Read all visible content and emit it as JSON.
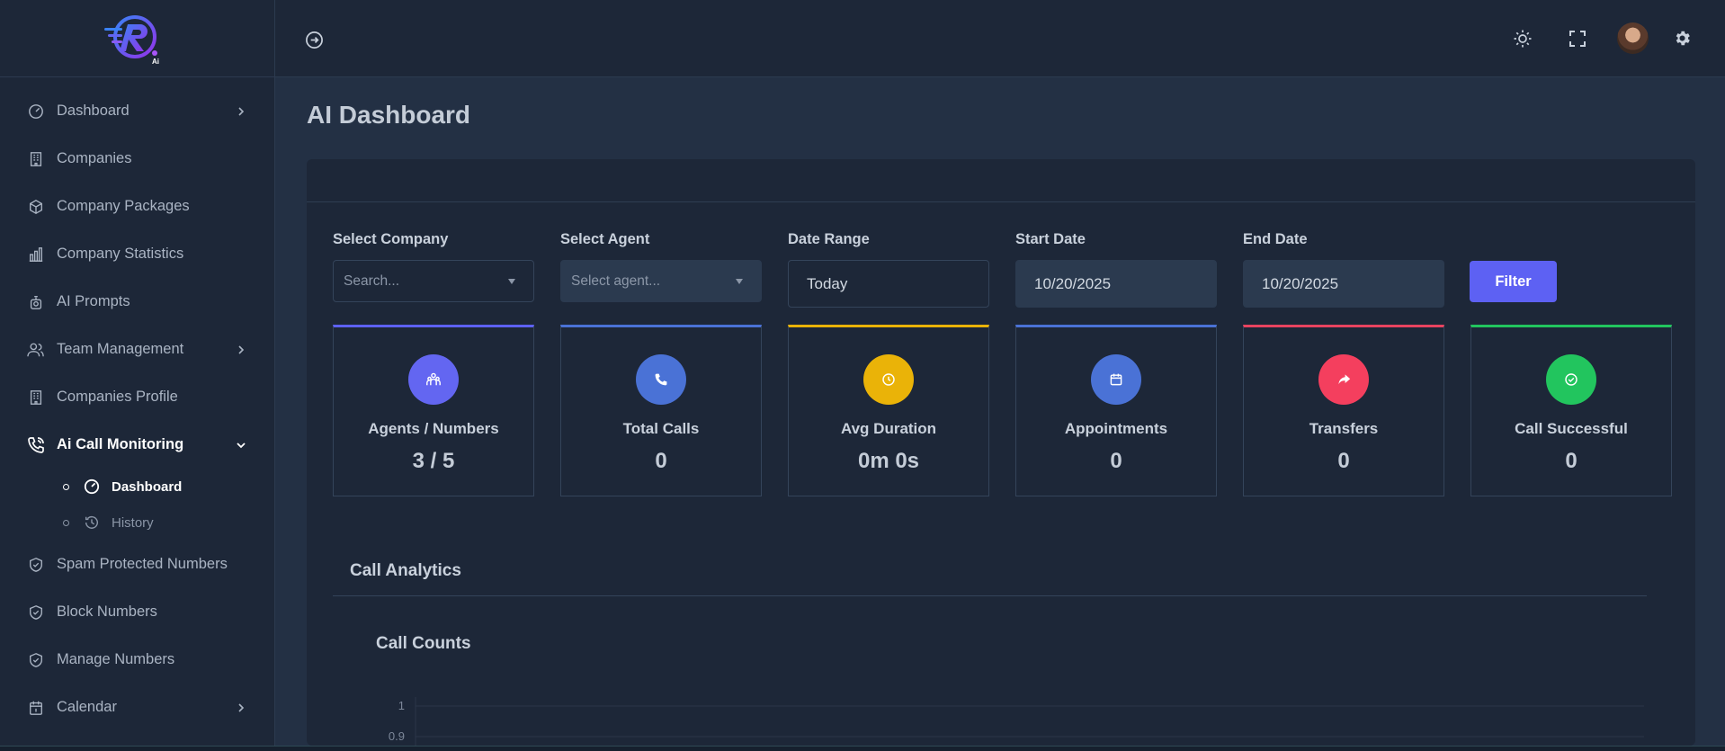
{
  "brand": {
    "logo_badge": "Ai",
    "accent": "#5d61f3"
  },
  "sidebar": {
    "items": [
      {
        "label": "Dashboard",
        "icon": "gauge-icon",
        "has_submenu": true
      },
      {
        "label": "Companies",
        "icon": "building-icon",
        "has_submenu": false
      },
      {
        "label": "Company Packages",
        "icon": "package-icon",
        "has_submenu": false
      },
      {
        "label": "Company Statistics",
        "icon": "bar-chart-icon",
        "has_submenu": false
      },
      {
        "label": "AI Prompts",
        "icon": "robot-icon",
        "has_submenu": false
      },
      {
        "label": "Team Management",
        "icon": "users-icon",
        "has_submenu": true
      },
      {
        "label": "Companies Profile",
        "icon": "building-icon",
        "has_submenu": false
      },
      {
        "label": "Ai Call Monitoring",
        "icon": "phone-call-icon",
        "has_submenu": true,
        "expanded": true,
        "children": [
          {
            "label": "Dashboard",
            "icon": "gauge-icon",
            "active": true
          },
          {
            "label": "History",
            "icon": "history-icon",
            "active": false
          }
        ]
      },
      {
        "label": "Spam Protected Numbers",
        "icon": "shield-check-icon",
        "has_submenu": false
      },
      {
        "label": "Block Numbers",
        "icon": "shield-check-icon",
        "has_submenu": false
      },
      {
        "label": "Manage Numbers",
        "icon": "shield-check-icon",
        "has_submenu": false
      },
      {
        "label": "Calendar",
        "icon": "calendar-icon",
        "has_submenu": true
      }
    ]
  },
  "topbar": {
    "icons": [
      "sidebar-toggle-icon",
      "sun-icon",
      "fullscreen-icon",
      "avatar",
      "gear-icon"
    ]
  },
  "page": {
    "title": "AI Dashboard"
  },
  "filters": {
    "company": {
      "label": "Select Company",
      "placeholder": "Search..."
    },
    "agent": {
      "label": "Select Agent",
      "placeholder": "Select agent..."
    },
    "date_range": {
      "label": "Date Range",
      "value": "Today"
    },
    "start_date": {
      "label": "Start Date",
      "value": "10/20/2025"
    },
    "end_date": {
      "label": "End Date",
      "value": "10/20/2025"
    },
    "button": "Filter"
  },
  "stats": [
    {
      "title": "Agents / Numbers",
      "value": "3 / 5",
      "color": "#6366f1",
      "border": "#5d61f3",
      "icon": "users-icon"
    },
    {
      "title": "Total Calls",
      "value": "0",
      "color": "#4a72d6",
      "border": "#4a72d6",
      "icon": "phone-icon"
    },
    {
      "title": "Avg Duration",
      "value": "0m 0s",
      "color": "#eab308",
      "border": "#eab308",
      "icon": "clock-icon"
    },
    {
      "title": "Appointments",
      "value": "0",
      "color": "#4a72d6",
      "border": "#4a72d6",
      "icon": "calendar-icon"
    },
    {
      "title": "Transfers",
      "value": "0",
      "color": "#f43f5e",
      "border": "#e8435f",
      "icon": "share-icon"
    },
    {
      "title": "Call Successful",
      "value": "0",
      "color": "#22c55e",
      "border": "#22c55e",
      "icon": "check-circle-icon"
    }
  ],
  "analytics": {
    "section_title": "Call Analytics",
    "chart_title": "Call Counts"
  },
  "chart_data": {
    "type": "line",
    "title": "Call Counts",
    "xlabel": "",
    "ylabel": "",
    "y_ticks": [
      "1",
      "0.9"
    ],
    "ylim": [
      0,
      1
    ],
    "series": []
  }
}
